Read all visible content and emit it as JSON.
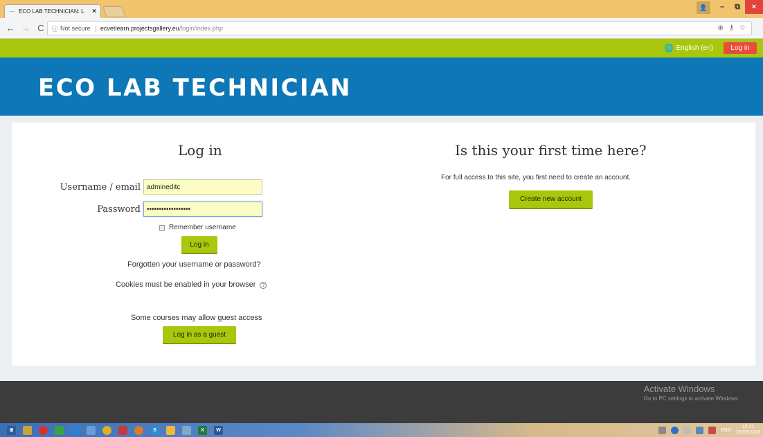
{
  "browser": {
    "tab_title": "ECO LAB TECHNICIAN: L",
    "tab_close": "×",
    "back": "←",
    "forward": "→",
    "reload": "C",
    "info_icon": "ⓘ",
    "security_label": "Not secure",
    "url_host": "ecvetlearn.projectsgallery.eu",
    "url_path": "/login/index.php",
    "window_controls": {
      "minimize": "–",
      "restore": "⧉",
      "close": "×"
    }
  },
  "topnav": {
    "language": "English (en)",
    "login_label": "Log in",
    "colors": {
      "bar": "#a9c70d",
      "login": "#e94b3c"
    }
  },
  "banner": {
    "site_title": "ECO LAB TECHNICIAN",
    "color": "#0d77b7"
  },
  "login": {
    "heading": "Log in",
    "username_label": "Username / email",
    "username_value": "admineditc",
    "password_label": "Password",
    "password_value": "••••••••••••••••••",
    "remember_label": "Remember username",
    "submit_label": "Log in",
    "forgot_link": "Forgotten your username or password?",
    "cookies_notice": "Cookies must be enabled in your browser",
    "guest_text": "Some courses may allow guest access",
    "guest_button": "Log in as a guest"
  },
  "signup": {
    "heading": "Is this your first time here?",
    "text": "For full access to this site, you first need to create an account.",
    "button": "Create new account"
  },
  "footer": {
    "activate_title": "Activate Windows",
    "activate_sub": "Go to PC settings to activate Windows."
  },
  "taskbar": {
    "lang": "ENG",
    "time": "15:21",
    "date": "25/09/2018"
  }
}
